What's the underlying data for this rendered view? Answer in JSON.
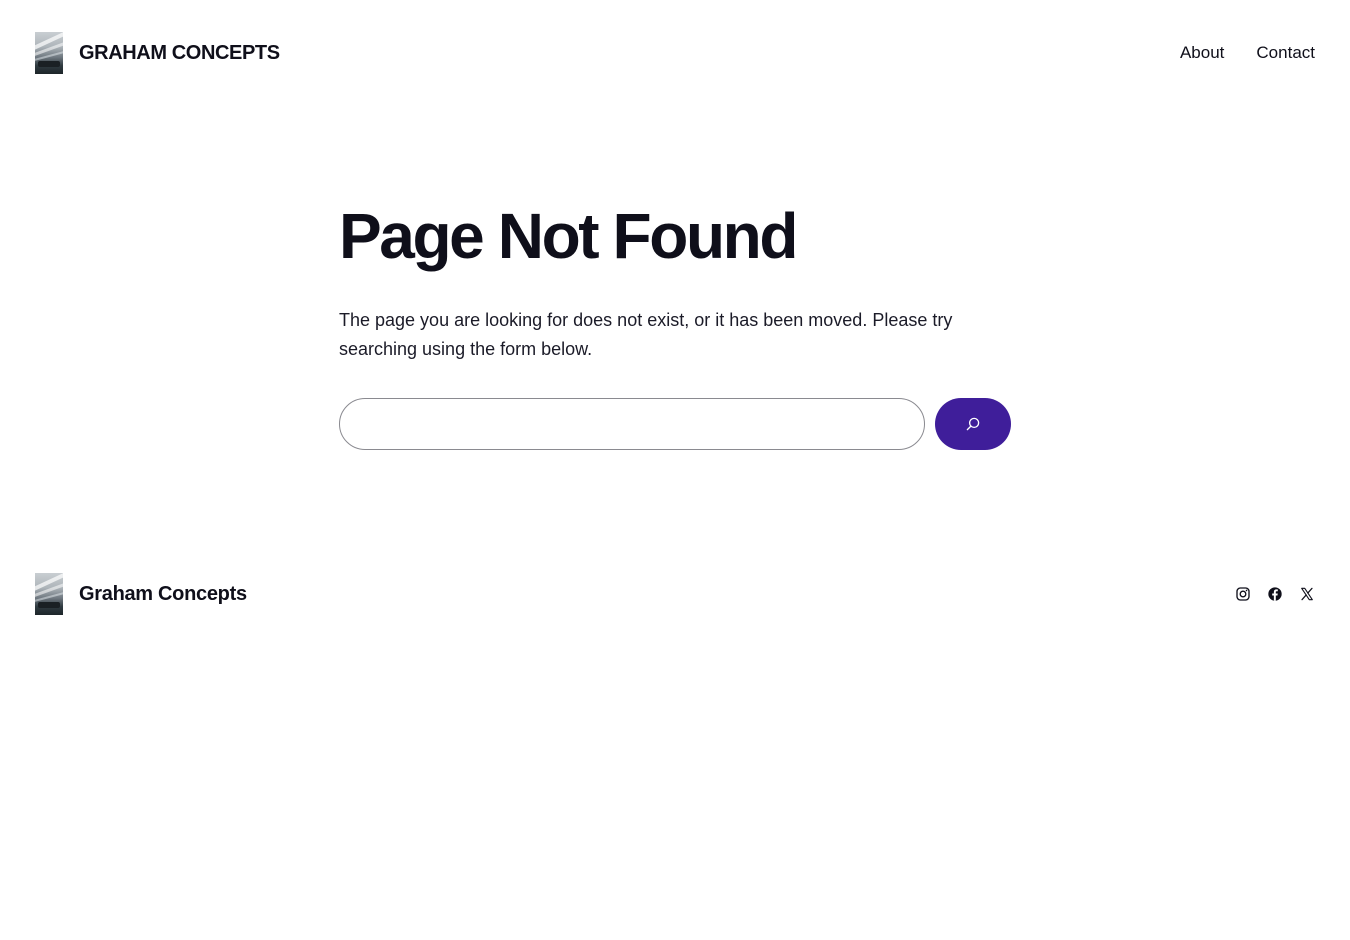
{
  "header": {
    "site_title": "GRAHAM CONCEPTS",
    "nav": [
      {
        "label": "About"
      },
      {
        "label": "Contact"
      }
    ]
  },
  "main": {
    "title": "Page Not Found",
    "message": "The page you are looking for does not exist, or it has been moved. Please try searching using the form below.",
    "search": {
      "value": "",
      "placeholder": "",
      "button_icon": "search-icon"
    }
  },
  "footer": {
    "site_title": "Graham Concepts",
    "social": [
      {
        "icon": "instagram-icon"
      },
      {
        "icon": "facebook-icon"
      },
      {
        "icon": "x-icon"
      }
    ]
  },
  "colors": {
    "accent": "#3f1e9a",
    "text": "#0f0f1a",
    "background": "#ffffff"
  }
}
